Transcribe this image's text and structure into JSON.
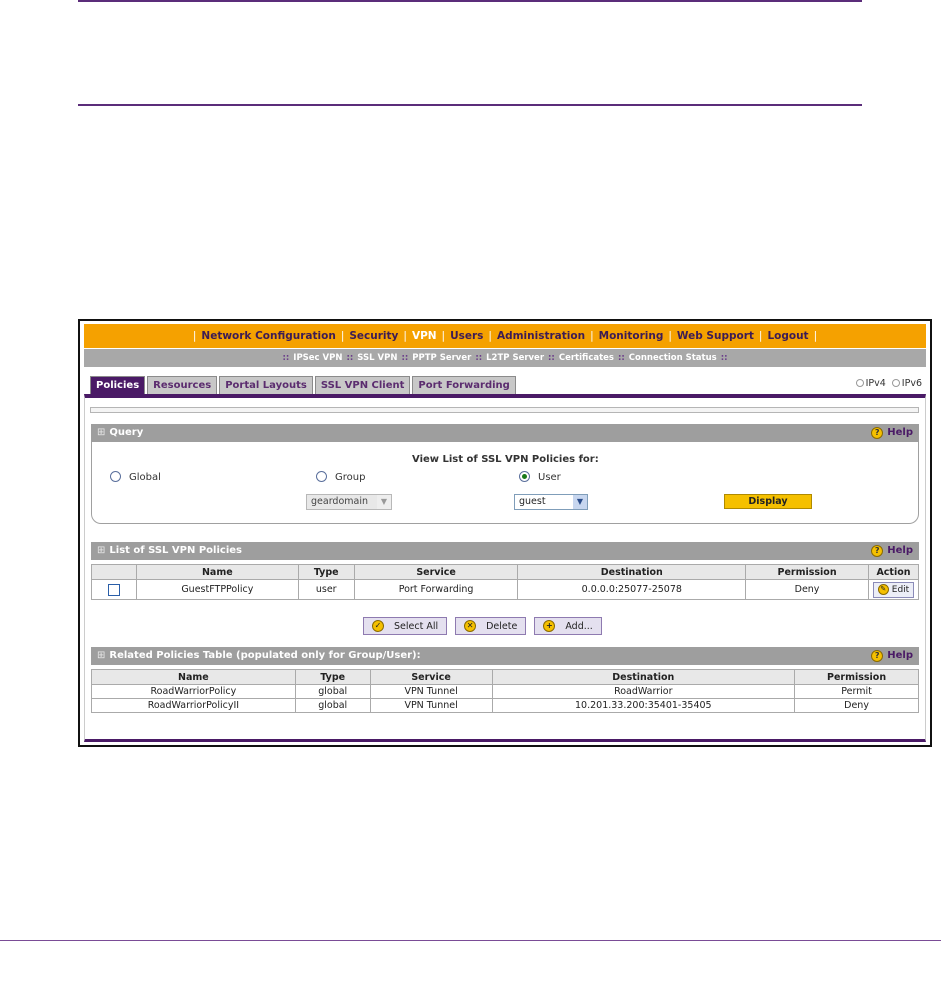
{
  "menu": {
    "items": [
      "Network Configuration",
      "Security",
      "VPN",
      "Users",
      "Administration",
      "Monitoring",
      "Web Support",
      "Logout"
    ],
    "active": "VPN"
  },
  "submenu": {
    "items": [
      "IPSec VPN",
      "SSL VPN",
      "PPTP Server",
      "L2TP Server",
      "Certificates",
      "Connection Status"
    ]
  },
  "tabs": [
    "Policies",
    "Resources",
    "Portal Layouts",
    "SSL VPN Client",
    "Port Forwarding"
  ],
  "ip": {
    "ipv4": "IPv4",
    "ipv6": "IPv6"
  },
  "query": {
    "header": "Query",
    "help": "Help",
    "title": "View List of SSL VPN Policies for:",
    "global_label": "Global",
    "group_label": "Group",
    "user_label": "User",
    "group_value": "geardomain",
    "user_value": "guest",
    "display_label": "Display"
  },
  "policies": {
    "header": "List of SSL VPN Policies",
    "help": "Help",
    "columns": [
      "Name",
      "Type",
      "Service",
      "Destination",
      "Permission",
      "Action"
    ],
    "rows": [
      {
        "name": "GuestFTPPolicy",
        "type": "user",
        "service": "Port Forwarding",
        "destination": "0.0.0.0:25077-25078",
        "permission": "Deny",
        "action": "Edit"
      }
    ],
    "select_all": "Select All",
    "delete": "Delete",
    "add": "Add..."
  },
  "related": {
    "header": "Related Policies Table (populated only for Group/User):",
    "help": "Help",
    "columns": [
      "Name",
      "Type",
      "Service",
      "Destination",
      "Permission"
    ],
    "rows": [
      {
        "name": "RoadWarriorPolicy",
        "type": "global",
        "service": "VPN Tunnel",
        "destination": "RoadWarrior",
        "permission": "Permit"
      },
      {
        "name": "RoadWarriorPolicyII",
        "type": "global",
        "service": "VPN Tunnel",
        "destination": "10.201.33.200:35401-35405",
        "permission": "Deny"
      }
    ]
  }
}
